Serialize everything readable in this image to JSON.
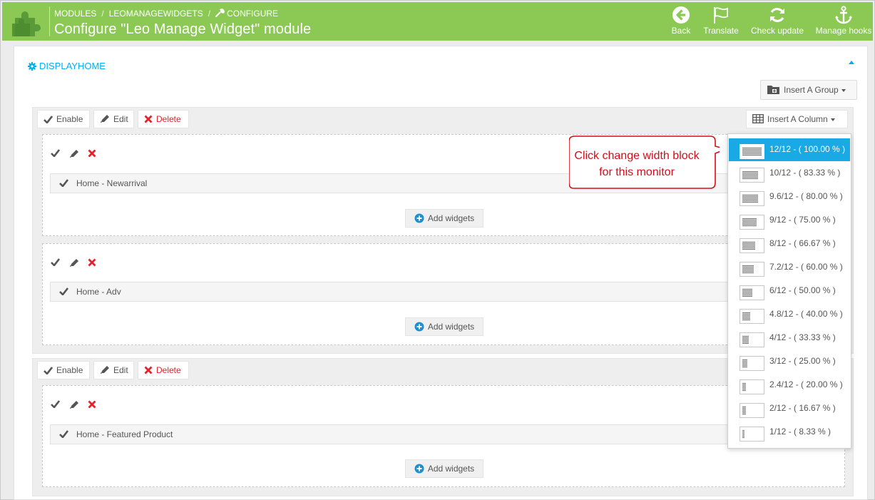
{
  "breadcrumb": [
    "MODULES",
    "LEOMANAGEWIDGETS",
    "CONFIGURE"
  ],
  "page_title": "Configure \"Leo Manage Widget\" module",
  "toolbar": [
    {
      "id": "back",
      "label": "Back",
      "icon": "back-arrow-icon"
    },
    {
      "id": "translate",
      "label": "Translate",
      "icon": "flag-icon"
    },
    {
      "id": "check_update",
      "label": "Check update",
      "icon": "refresh-icon"
    },
    {
      "id": "manage_hooks",
      "label": "Manage hooks",
      "icon": "anchor-icon"
    }
  ],
  "panel": {
    "title": "DISPLAYHOME"
  },
  "buttons": {
    "insert_group": "Insert A Group",
    "insert_column": "Insert A Column",
    "enable": "Enable",
    "edit": "Edit",
    "delete": "Delete",
    "add_widgets": "Add widgets"
  },
  "groups": [
    {
      "columns": [
        {
          "widget": "Home - Newarrival"
        },
        {
          "widget": "Home - Adv"
        }
      ]
    },
    {
      "columns": [
        {
          "widget": "Home - Featured Product"
        }
      ]
    }
  ],
  "column_width_options": [
    {
      "label": "12/12 - ( 100.00 % )",
      "fraction": 1.0
    },
    {
      "label": "10/12 - ( 83.33 % )",
      "fraction": 0.8333
    },
    {
      "label": "9.6/12 - ( 80.00 % )",
      "fraction": 0.8
    },
    {
      "label": "9/12 - ( 75.00 % )",
      "fraction": 0.75
    },
    {
      "label": "8/12 - ( 66.67 % )",
      "fraction": 0.6667
    },
    {
      "label": "7.2/12 - ( 60.00 % )",
      "fraction": 0.6
    },
    {
      "label": "6/12 - ( 50.00 % )",
      "fraction": 0.5
    },
    {
      "label": "4.8/12 - ( 40.00 % )",
      "fraction": 0.4
    },
    {
      "label": "4/12 - ( 33.33 % )",
      "fraction": 0.3333
    },
    {
      "label": "3/12 - ( 25.00 % )",
      "fraction": 0.25
    },
    {
      "label": "2.4/12 - ( 20.00 % )",
      "fraction": 0.2
    },
    {
      "label": "2/12 - ( 16.67 % )",
      "fraction": 0.1667
    },
    {
      "label": "1/12 - ( 8.33 % )",
      "fraction": 0.0833
    }
  ],
  "selected_width_index": 0,
  "callout": {
    "line1": "Click change width block",
    "line2": "for this monitor"
  },
  "colors": {
    "header": "#8bc954",
    "accent": "#00aff0",
    "active": "#19a9e5",
    "delete": "#e2222d",
    "callout": "#d80c18"
  }
}
